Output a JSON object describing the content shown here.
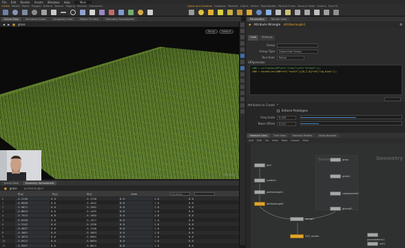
{
  "menubar": [
    "File",
    "Edit",
    "Render",
    "Assets",
    "Windows",
    "Help",
    "Main"
  ],
  "shelf_left": {
    "tabs": [
      "Create",
      "Modify",
      "Model",
      "Polygon",
      "Deform",
      "Texture",
      "Rigging",
      "Muscles",
      "Characters"
    ]
  },
  "shelf_right": {
    "tabs": [
      "Lights and Cameras",
      "Collisions",
      "Particles",
      "Grains",
      "Vellum",
      "Rigid Bodies",
      "Particle Fluids",
      "Viscous Fluids",
      "Oceans",
      "Pyro FX"
    ]
  },
  "viewport": {
    "tabs": [
      "Scene View",
      "Animation Editor",
      "Composite View",
      "Motion FX View",
      "Geometry Spreadsheet"
    ],
    "path": "grass",
    "camera": "Persp",
    "camera_label": "No cam",
    "display": "Default"
  },
  "spreadsheet": {
    "tabs": [
      "Scene View",
      "Geometry Spreadsheet"
    ],
    "path": "grass",
    "node": "pointwrangle1",
    "headers": [
      "",
      "P[x]",
      "P[y]",
      "P[z]",
      "N[x]",
      "N[y]",
      "N[z]"
    ],
    "view_label": "View",
    "intrinsics_label": "Intrinsics",
    "rows": [
      [
        "0",
        "-4.2136",
        "0.0",
        "-5.1728",
        "0.0",
        "1.0",
        "0.0"
      ],
      [
        "1",
        "-4.0958",
        "0.0",
        "-5.1642",
        "0.0",
        "1.0",
        "0.0"
      ],
      [
        "2",
        "-3.9871",
        "0.0",
        "-5.1581",
        "0.0",
        "1.0",
        "0.0"
      ],
      [
        "3",
        "-3.8624",
        "0.0",
        "-5.1495",
        "0.0",
        "1.0",
        "0.0"
      ],
      [
        "4",
        "-3.7513",
        "0.0",
        "-5.1402",
        "0.0",
        "1.0",
        "0.0"
      ],
      [
        "5",
        "-3.6338",
        "0.0",
        "-5.1317",
        "0.0",
        "1.0",
        "0.0"
      ],
      [
        "6",
        "-3.5142",
        "0.0",
        "-5.1236",
        "0.0",
        "1.0",
        "0.0"
      ],
      [
        "7",
        "-3.4027",
        "0.0",
        "-5.1148",
        "0.0",
        "1.0",
        "0.0"
      ],
      [
        "8",
        "-3.2861",
        "0.0",
        "-5.1063",
        "0.0",
        "1.0",
        "0.0"
      ],
      [
        "9",
        "-3.1674",
        "0.0",
        "-5.0981",
        "0.0",
        "1.0",
        "0.0"
      ],
      [
        "10",
        "-3.0512",
        "0.0",
        "-5.0894",
        "0.0",
        "1.0",
        "0.0"
      ],
      [
        "11",
        "-2.9357",
        "0.0",
        "-5.0812",
        "0.0",
        "1.0",
        "0.0"
      ]
    ]
  },
  "params": {
    "tabs": [
      "Parameters",
      "Render View"
    ],
    "title": "Attribute Wrangle",
    "node": "attribwrangle1",
    "subtabs": [
      "Code",
      "Bindings"
    ],
    "group_label": "Group",
    "group_type_label": "Group Type",
    "group_type_value": "Guess from Group",
    "run_over_label": "Run Over",
    "run_over_value": "Points",
    "vex_label": "VEXpression",
    "code": [
      "v@N = curlnoise(@P*chf(\"freq\")+chf(\"offset\"));",
      "v@N = normalize(v@N*chf(\"scale\")+{0,1,0}*chf(\"up_bias\"));"
    ],
    "attrib_label": "Attributes to Create",
    "attrib_value": "*",
    "enforce_label": "Enforce Prototypes",
    "freq_label": "Freq Scale",
    "freq_value": "0.333",
    "offset_label": "Noise Offset",
    "offset_value": "0.211",
    "freq_fraction": 0.55,
    "offset_fraction": 0.18
  },
  "network": {
    "tabs": [
      "Network View",
      "Tree View",
      "Material Palette",
      "Asset Browser"
    ],
    "tools": [
      "Add",
      "Edit",
      "Go",
      "View",
      "Tools",
      "Layout",
      "Help"
    ],
    "context_label": "Geometry",
    "sticky_label": "Geometry",
    "nodes": [
      {
        "name": "grid",
        "color": "gray"
      },
      {
        "name": "scatter1",
        "color": "gray"
      },
      {
        "name": "pointwrangle1",
        "color": "gray"
      },
      {
        "name": "attribwrangle1",
        "color": "yellow"
      },
      {
        "name": "grass",
        "color": "gray"
      },
      {
        "name": "guide1",
        "color": "gray"
      },
      {
        "name": "copytopoints1",
        "color": "gray"
      },
      {
        "name": "ground1",
        "color": "gray"
      },
      {
        "name": "merge1",
        "color": "gray"
      },
      {
        "name": "OUT_render",
        "color": "yellow"
      },
      {
        "name": "groomdeform1",
        "color": "gray"
      },
      {
        "name": "null1",
        "color": "gray"
      }
    ]
  },
  "colors": {
    "accent": "#e0a030",
    "grass_dark": "#2d4a14",
    "grass_light": "#8da84a",
    "node_yellow": "#e1a52c"
  }
}
